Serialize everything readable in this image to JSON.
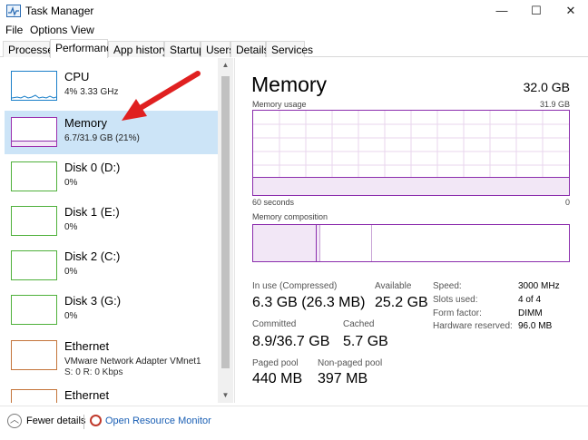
{
  "window": {
    "title": "Task Manager",
    "minimize": "—",
    "maximize": "☐",
    "close": "✕"
  },
  "menu": [
    "File",
    "Options",
    "View"
  ],
  "tabs": [
    "Processes",
    "Performance",
    "App history",
    "Startup",
    "Users",
    "Details",
    "Services"
  ],
  "sidebar": {
    "items": [
      {
        "name": "CPU",
        "sub": "4% 3.33 GHz",
        "sub2": ""
      },
      {
        "name": "Memory",
        "sub": "6.7/31.9 GB (21%)",
        "sub2": ""
      },
      {
        "name": "Disk 0 (D:)",
        "sub": "0%",
        "sub2": ""
      },
      {
        "name": "Disk 1 (E:)",
        "sub": "0%",
        "sub2": ""
      },
      {
        "name": "Disk 2 (C:)",
        "sub": "0%",
        "sub2": ""
      },
      {
        "name": "Disk 3 (G:)",
        "sub": "0%",
        "sub2": ""
      },
      {
        "name": "Ethernet",
        "sub": "VMware Network Adapter VMnet1",
        "sub2": "S: 0 R: 0 Kbps"
      },
      {
        "name": "Ethernet",
        "sub": "",
        "sub2": ""
      }
    ]
  },
  "memory": {
    "title": "Memory",
    "total": "32.0 GB",
    "usage_label": "Memory usage",
    "usage_max": "31.9 GB",
    "time_left": "60 seconds",
    "time_right": "0",
    "composition_label": "Memory composition",
    "usage_level": 0.21,
    "stats": {
      "in_use_label": "In use (Compressed)",
      "in_use_value": "6.3 GB (26.3 MB)",
      "available_label": "Available",
      "available_value": "25.2 GB",
      "committed_label": "Committed",
      "committed_value": "8.9/36.7 GB",
      "cached_label": "Cached",
      "cached_value": "5.7 GB",
      "paged_label": "Paged pool",
      "paged_value": "440 MB",
      "nonpaged_label": "Non-paged pool",
      "nonpaged_value": "397 MB"
    },
    "specs": {
      "speed_label": "Speed:",
      "speed_value": "3000 MHz",
      "slots_label": "Slots used:",
      "slots_value": "4 of 4",
      "form_label": "Form factor:",
      "form_value": "DIMM",
      "hw_label": "Hardware reserved:",
      "hw_value": "96.0 MB"
    }
  },
  "footer": {
    "fewer_details": "Fewer details",
    "resource_monitor": "Open Resource Monitor"
  },
  "colors": {
    "memory": "#8b2dad",
    "cpu": "#1a7fc9",
    "disk": "#4eb03a",
    "ethernet": "#c4743a",
    "selected": "#cce4f7",
    "arrow": "#e02020"
  }
}
